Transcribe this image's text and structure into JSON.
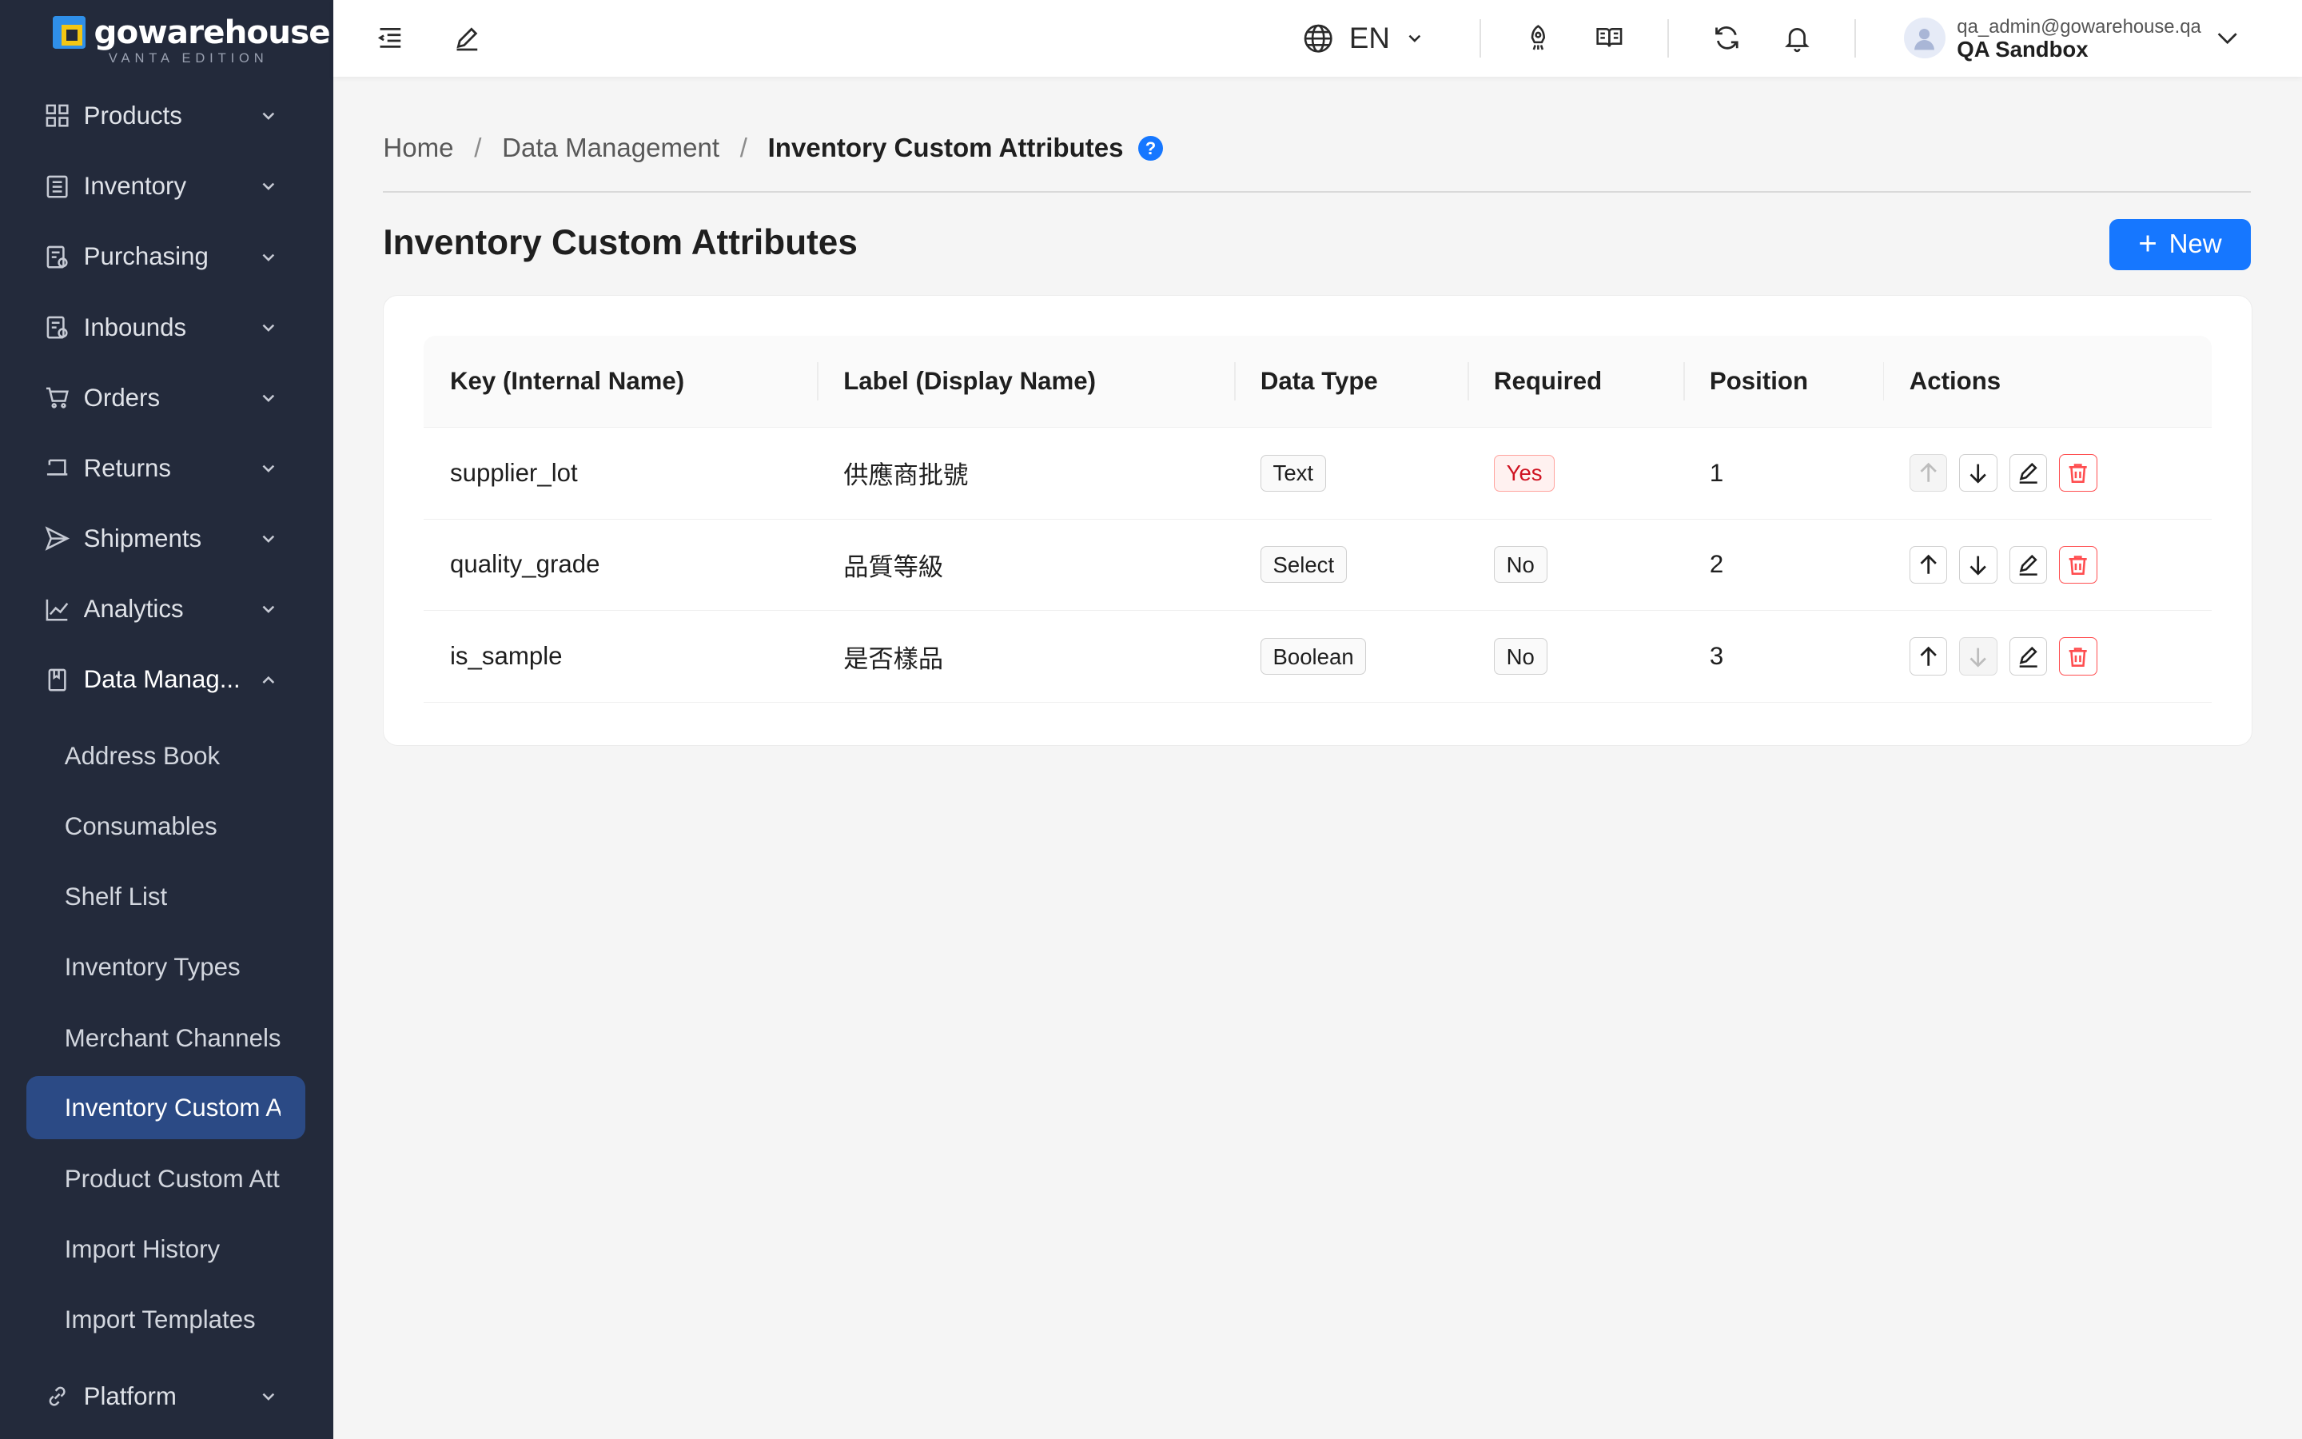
{
  "logo": {
    "name": "gowarehouse",
    "edition": "VANTA EDITION"
  },
  "sidebar": {
    "items": [
      {
        "label": "Products",
        "icon": "grid-icon"
      },
      {
        "label": "Inventory",
        "icon": "inventory-icon"
      },
      {
        "label": "Purchasing",
        "icon": "purchasing-icon"
      },
      {
        "label": "Inbounds",
        "icon": "inbounds-icon"
      },
      {
        "label": "Orders",
        "icon": "cart-icon"
      },
      {
        "label": "Returns",
        "icon": "return-icon"
      },
      {
        "label": "Shipments",
        "icon": "send-icon"
      },
      {
        "label": "Analytics",
        "icon": "chart-icon"
      },
      {
        "label": "Data Manag...",
        "icon": "book-icon"
      }
    ],
    "sub_items": [
      {
        "label": "Address Book"
      },
      {
        "label": "Consumables"
      },
      {
        "label": "Shelf List"
      },
      {
        "label": "Inventory Types"
      },
      {
        "label": "Merchant Channels"
      },
      {
        "label": "Inventory Custom Attributes"
      },
      {
        "label": "Product Custom Attributes"
      },
      {
        "label": "Import History"
      },
      {
        "label": "Import Templates"
      }
    ],
    "platform": {
      "label": "Platform",
      "icon": "link-icon"
    }
  },
  "header": {
    "language": "EN",
    "user_email": "qa_admin@gowarehouse.qa",
    "user_org": "QA Sandbox"
  },
  "breadcrumb": {
    "home": "Home",
    "section": "Data Management",
    "current": "Inventory Custom Attributes",
    "help": "?"
  },
  "page": {
    "title": "Inventory Custom Attributes",
    "new_button": "New"
  },
  "table": {
    "columns": [
      "Key (Internal Name)",
      "Label (Display Name)",
      "Data Type",
      "Required",
      "Position",
      "Actions"
    ],
    "rows": [
      {
        "key": "supplier_lot",
        "label": "供應商批號",
        "type": "Text",
        "required": "Yes",
        "position": "1"
      },
      {
        "key": "quality_grade",
        "label": "品質等級",
        "type": "Select",
        "required": "No",
        "position": "2"
      },
      {
        "key": "is_sample",
        "label": "是否樣品",
        "type": "Boolean",
        "required": "No",
        "position": "3"
      }
    ]
  },
  "colors": {
    "sidebar_bg": "#232a3b",
    "active_item": "#2b4a85",
    "primary": "#1677ff",
    "danger": "#ff4d4f"
  }
}
